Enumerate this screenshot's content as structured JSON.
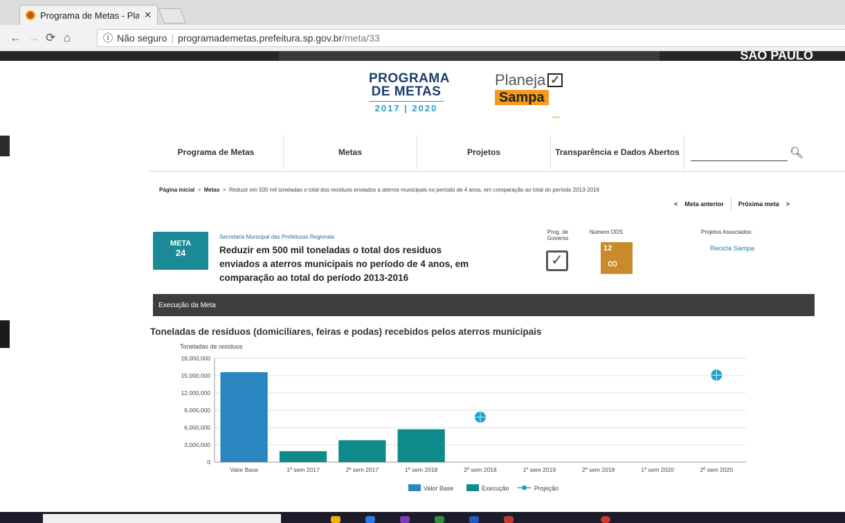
{
  "browser": {
    "tab_title": "Programa de Metas - Pla",
    "tab_close": "✕",
    "security_label": "Não seguro",
    "url_host": "programademetas.prefeitura.sp.gov.br",
    "url_path": "/meta/33"
  },
  "site": {
    "city_logo_text": "SÃO PAULO",
    "logo_programa": {
      "line1": "PROGRAMA",
      "line2": "DE METAS",
      "years": "2017 | 2020"
    },
    "logo_planeja": {
      "line1": "Planeja",
      "line2": "Sampa",
      "beta": "beta"
    },
    "nav": [
      "Programa de Metas",
      "Metas",
      "Projetos",
      "Transparência e Dados Abertos"
    ]
  },
  "breadcrumb": {
    "home": "Página inicial",
    "metas": "Metas",
    "current": "Reduzir em 500 mil toneladas o total dos resíduos enviados a aterros municipais no período de 4 anos, em comparação ao total do período 2013-2016"
  },
  "meta_nav": {
    "prev": "Meta anterior",
    "next": "Próxima meta"
  },
  "meta": {
    "badge_label": "META",
    "badge_number": "24",
    "secretaria": "Secretaria Municipal das Prefeituras Regionais",
    "title": "Reduzir em 500 mil toneladas o total dos resíduos enviados a aterros municipais no período de 4 anos, em comparação ao total do período 2013-2016",
    "prog_label": "Prog. de Governo",
    "ods_label": "Número ODS",
    "ods_number": "12",
    "proj_label": "Projetos Associados:",
    "proj_link": "Recicla Sampa"
  },
  "section_title": "Execução da Meta",
  "chart_title": "Toneladas de resíduos (domiciliares, feiras e podas)  recebidos pelos aterros municipais",
  "colors": {
    "valor_base": "#2a86bf",
    "execucao": "#0e8a8a",
    "projecao": "#1ba3cf"
  },
  "chart_data": {
    "type": "bar",
    "ylabel": "Toneladas de resíduos",
    "ylim": [
      0,
      18000000
    ],
    "yticks": [
      "0",
      "3,000,000",
      "6,000,000",
      "9,000,000",
      "12,000,000",
      "15,000,000",
      "18,000,000"
    ],
    "categories": [
      "Valor Base",
      "1º sem 2017",
      "2º sem 2017",
      "1º sem 2018",
      "2º sem 2018",
      "1º sem 2019",
      "2º sem 2019",
      "1º sem 2020",
      "2º sem 2020"
    ],
    "series": [
      {
        "name": "Valor Base",
        "kind": "bar",
        "values": [
          15600000,
          null,
          null,
          null,
          null,
          null,
          null,
          null,
          null
        ]
      },
      {
        "name": "Execução",
        "kind": "bar",
        "values": [
          null,
          1900000,
          3800000,
          5700000,
          null,
          null,
          null,
          null,
          null
        ]
      },
      {
        "name": "Projeção",
        "kind": "point",
        "values": [
          null,
          null,
          null,
          null,
          7800000,
          null,
          null,
          null,
          15100000
        ]
      }
    ],
    "legend_position": "bottom-center",
    "grid": true
  }
}
